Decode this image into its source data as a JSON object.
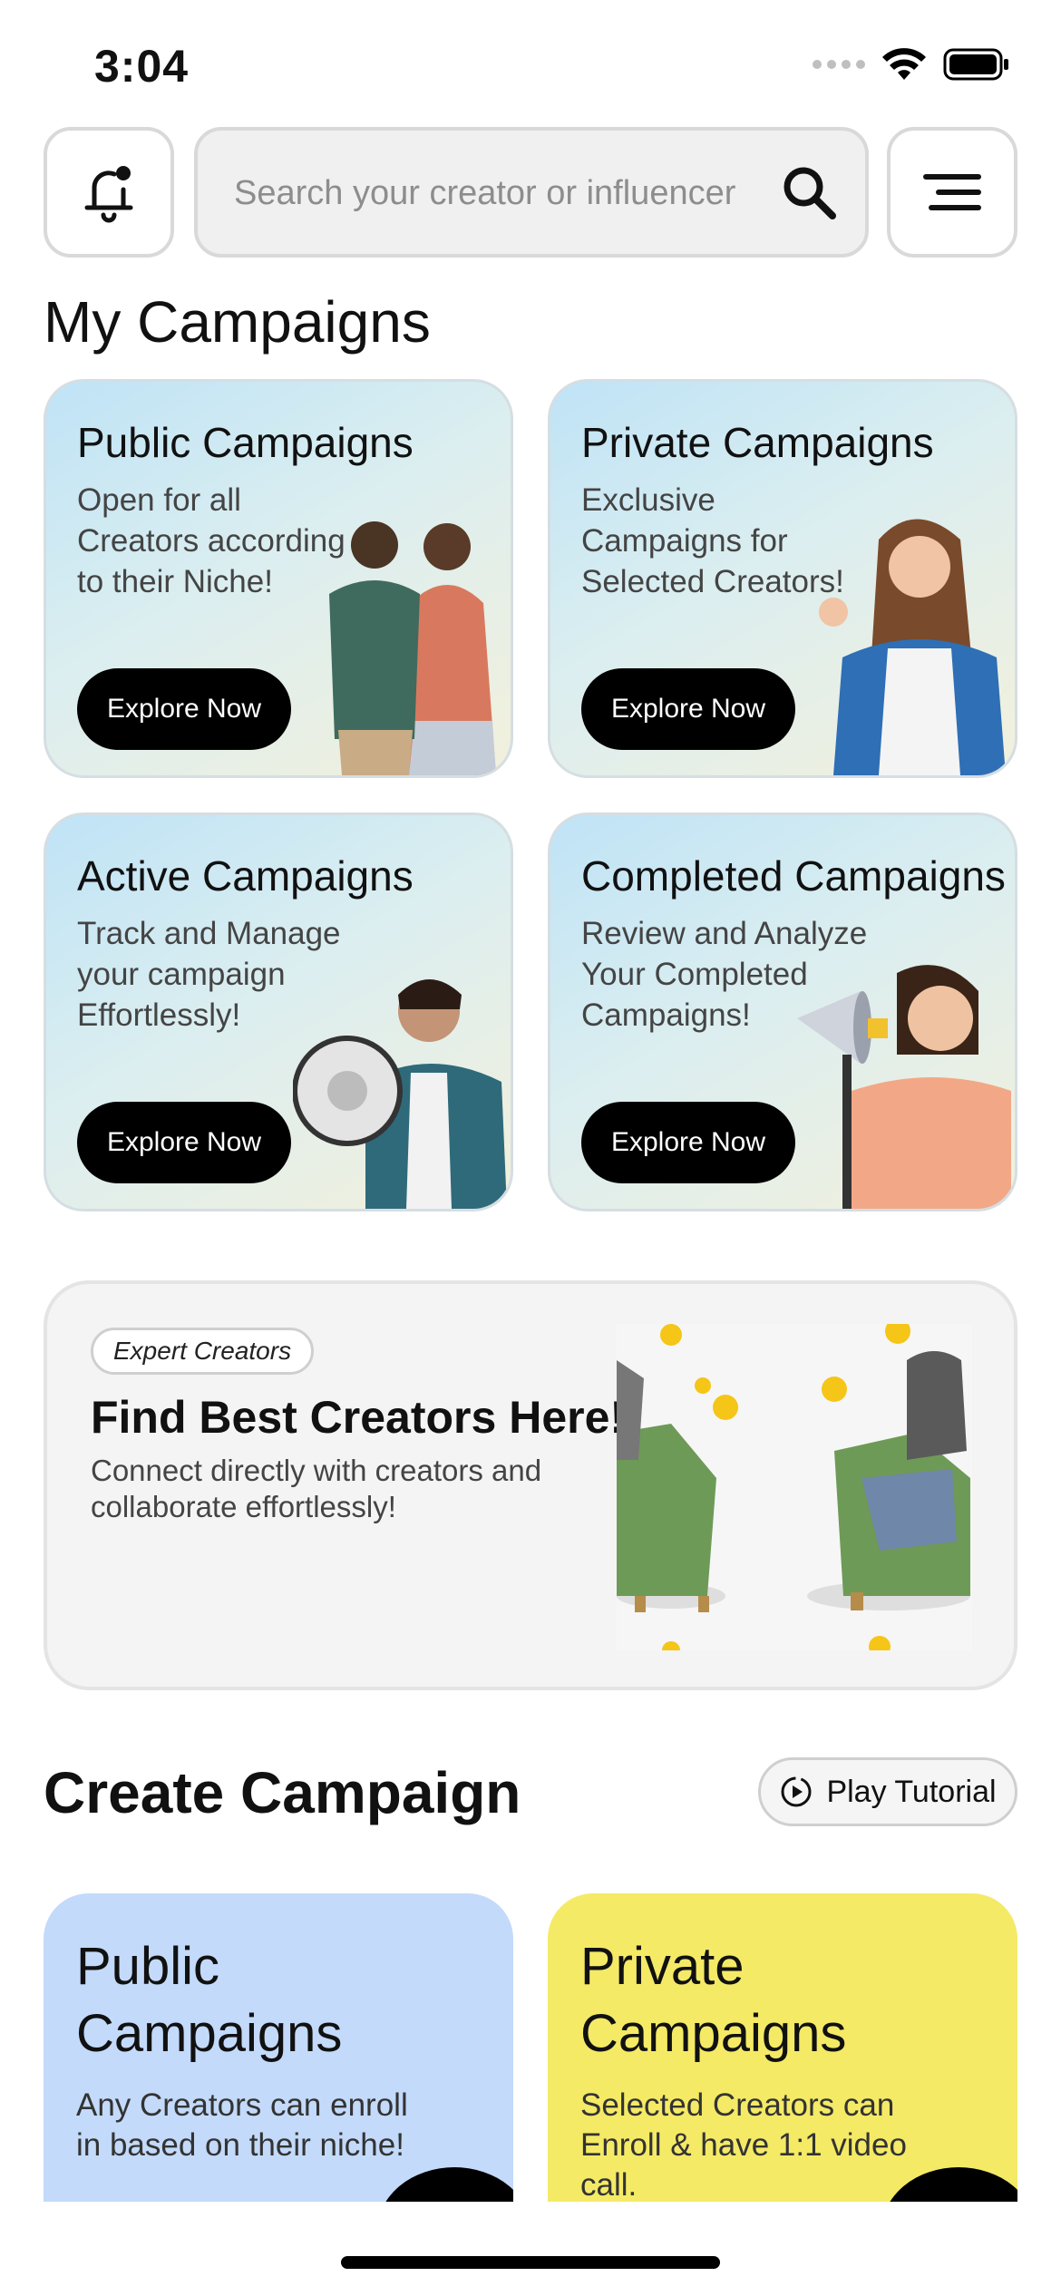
{
  "status": {
    "time": "3:04"
  },
  "search": {
    "placeholder": "Search your creator or influencer"
  },
  "my_campaigns": {
    "title": "My Campaigns",
    "cards": [
      {
        "title": "Public Campaigns",
        "description": "Open for all Creators according to their Niche!",
        "button": "Explore Now"
      },
      {
        "title": "Private Campaigns",
        "description": "Exclusive Campaigns for Selected Creators!",
        "button": "Explore Now"
      },
      {
        "title": "Active Campaigns",
        "description": "Track and Manage your campaign Effortlessly!",
        "button": "Explore Now"
      },
      {
        "title": "Completed Campaigns",
        "description": "Review and Analyze Your Completed Campaigns!",
        "button": "Explore Now"
      }
    ]
  },
  "expert": {
    "tag": "Expert Creators",
    "title": "Find Best Creators Here!",
    "description": "Connect directly with creators and collaborate effortlessly!"
  },
  "create": {
    "title": "Create Campaign",
    "tutorial": "Play Tutorial",
    "cards": [
      {
        "title": "Public Campaigns",
        "description": "Any Creators can enroll in based on their niche!",
        "color": "#c3dafa"
      },
      {
        "title": "Private Campaigns",
        "description": "Selected Creators can Enroll & have 1:1 video call.",
        "color": "#f4ea66"
      }
    ]
  },
  "icons": {
    "notifications": "bell-icon",
    "search": "search-icon",
    "menu": "menu-icon",
    "play": "play-circle-icon"
  }
}
